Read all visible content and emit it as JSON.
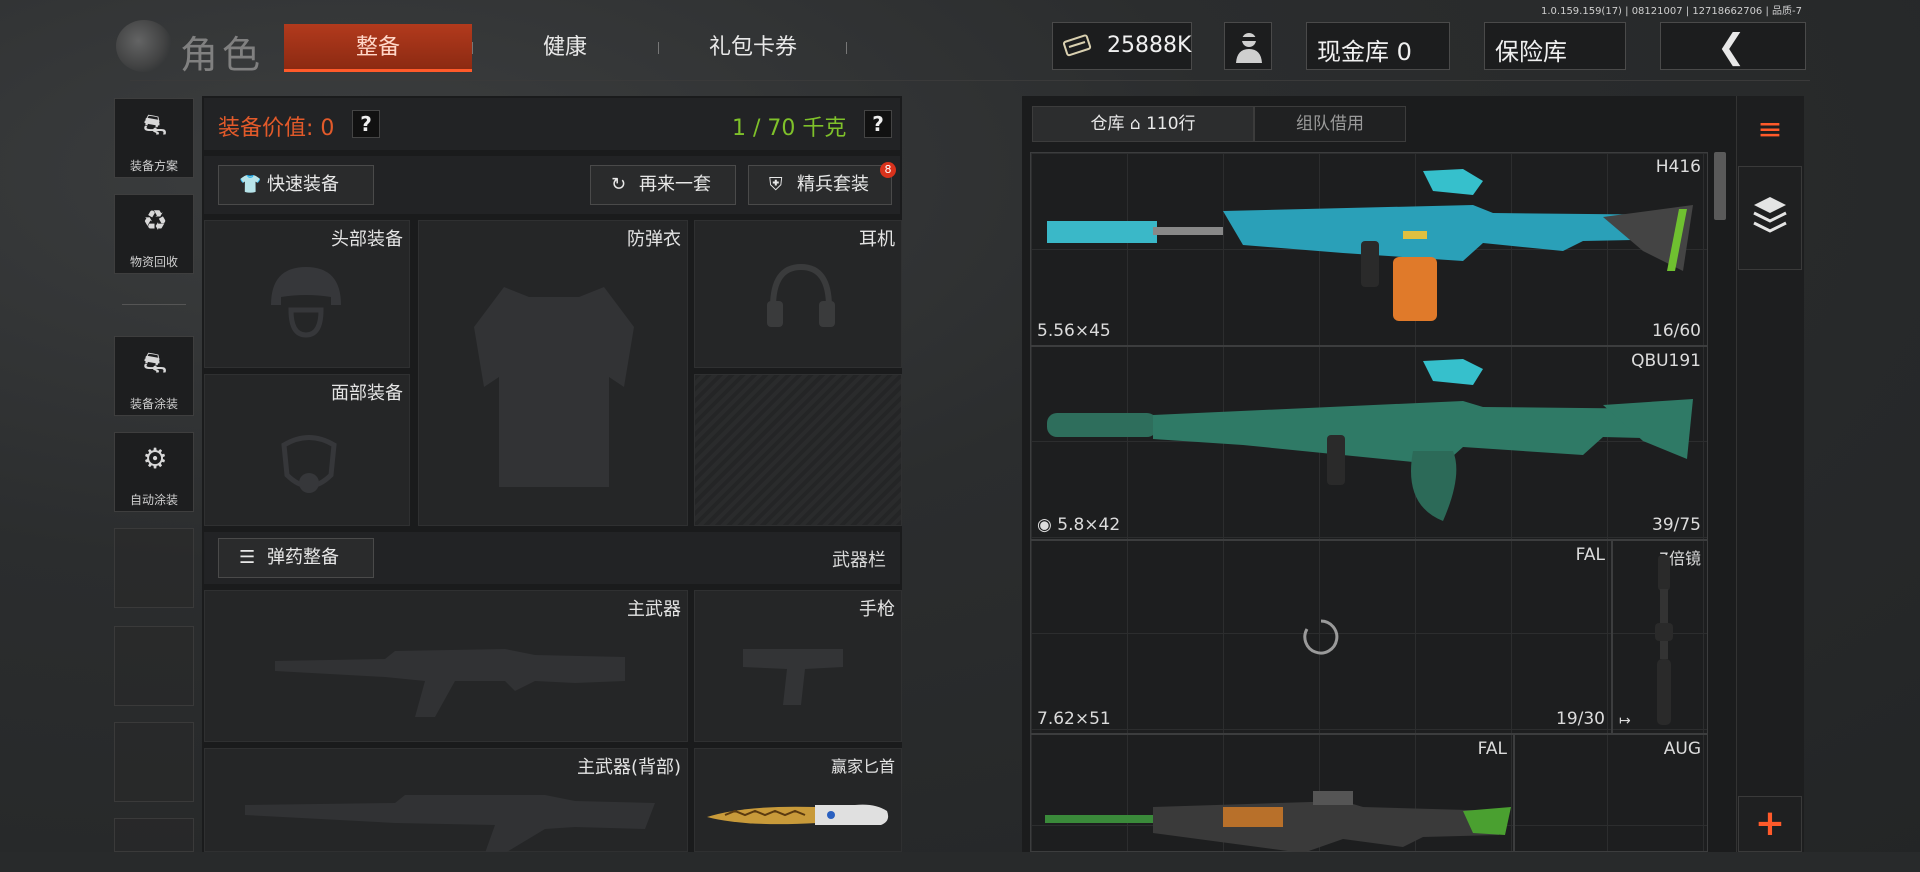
{
  "version_text": "1.0.159.159(17) | 08121007 | 12718662706 | 品质-7",
  "header": {
    "title": "角色",
    "tabs": [
      "整备",
      "健康",
      "礼包卡券"
    ],
    "money": "25888K",
    "cash_vault": "现金库 0",
    "safe_vault": "保险库"
  },
  "sidebar": {
    "items": [
      {
        "label": "装备方案",
        "icon": "helmet-grid-icon"
      },
      {
        "label": "物资回收",
        "icon": "recycle-face-icon"
      },
      {
        "label": "装备涂装",
        "icon": "painted-helmet-icon"
      },
      {
        "label": "自动涂装",
        "icon": "brush-gear-icon"
      }
    ]
  },
  "equip": {
    "value_label": "装备价值: 0",
    "help": "?",
    "weight": "1 / 70 千克",
    "quick_equip": "快速装备",
    "again_set": "再来一套",
    "elite_set": "精兵套装",
    "elite_badge": "8",
    "slots": {
      "head": "头部装备",
      "vest": "防弹衣",
      "earphone": "耳机",
      "face": "面部装备",
      "ammo_btn": "弹药整备",
      "weapon_bar": "武器栏",
      "primary": "主武器",
      "pistol": "手枪",
      "primary_back": "主武器(背部)",
      "knife": "赢家匕首"
    }
  },
  "warehouse": {
    "tab_store": "仓库",
    "tab_store_rows": "110行",
    "tab_team": "组队借用",
    "items": [
      {
        "name": "H416",
        "ammo": "5.56×45",
        "count": "16/60"
      },
      {
        "name": "QBU191",
        "ammo": "5.8×42",
        "count": "39/75"
      },
      {
        "name": "FAL",
        "ammo": "7.62×51",
        "count": "19/30"
      },
      {
        "name": "7倍镜"
      },
      {
        "name": "FAL"
      },
      {
        "name": "AUG"
      }
    ]
  },
  "colors": {
    "accent": "#ff5a2a",
    "weight_green": "#7fc12a",
    "value_orange": "#e35a2a"
  }
}
